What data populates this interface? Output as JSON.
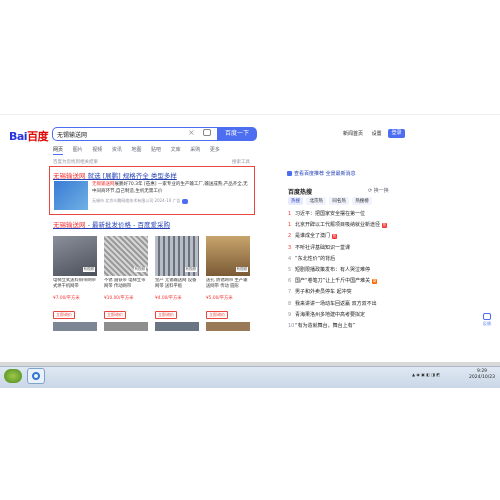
{
  "header": {
    "logo_left": "Bai",
    "logo_right": "百度",
    "search_value": "无锡输送网",
    "search_button": "百度一下",
    "links": [
      "新闻首页",
      "设置"
    ],
    "login": "登录"
  },
  "tabs": [
    "网页",
    "图片",
    "视频",
    "资讯",
    "地图",
    "贴吧",
    "文库",
    "采购",
    "更多"
  ],
  "result_hint": "百度为您找到相关结果",
  "search_tools": "搜索工具",
  "ad": {
    "title_kw": "无锡输送网",
    "title_rest": " 就选 [展鹏] 规格齐全 类型多样",
    "desc_kw": "无锡输送网",
    "desc_rest": "展鹏好70.3年 [莅惠] —家专业的生产输工厂,输送成熟,产品齐全,无中间商环节,自己制造,生机无需工价",
    "meta": "无锡市 北京众鹏网络技术有限公司 2024-10",
    "meta_tag": "广告"
  },
  "sub_result": {
    "title_kw": "无锡输送网",
    "title_rest": " - 最新批发价格 - 百度爱采购"
  },
  "products": [
    {
      "desc": "电梯立式送料铜带网带式烘干机网带",
      "price": "¥7.00/平方米",
      "button": "立即询价",
      "tag": "有视频"
    },
    {
      "desc": "不锈 圆铁带 电梯立带 网带 传动网带",
      "price": "¥10.00/平方米",
      "button": "立即询价",
      "tag": "有视频"
    },
    {
      "desc": "金产 无锡输送网 设备 网带 送料平板",
      "price": "¥4.00/平方米",
      "button": "立即询价",
      "tag": "有视频"
    },
    {
      "desc": "送孔 防锈网带 生产输 送网带 传动 圆形",
      "price": "¥5.00/平方米",
      "button": "立即询价",
      "tag": "有视频"
    }
  ],
  "sidebar": {
    "notice": "查看百度推荐 全景最新消息",
    "hot_title": "百度热搜",
    "change": "换一换",
    "hot_tabs": [
      "热搜",
      "北京热",
      "同名热",
      "热搜榜"
    ],
    "hot_items": [
      {
        "n": "1",
        "text": "习近平：把国家安全摆在第一位",
        "badge": ""
      },
      {
        "n": "1",
        "text": "北京开辟以工代赈项目吸纳就业新途径",
        "badge": "热"
      },
      {
        "n": "2",
        "text": "是谁成全了澳门",
        "badge": "热"
      },
      {
        "n": "3",
        "text": "不听社评基础知识一堂课",
        "badge": ""
      },
      {
        "n": "4",
        "text": "“东北性价”的背后",
        "badge": ""
      },
      {
        "n": "5",
        "text": "短剧限播政策发布：有人哭泣难停",
        "badge": ""
      },
      {
        "n": "6",
        "text": "国产“卷笔刀”让上千斤中国产难关",
        "badge": "新"
      },
      {
        "n": "7",
        "text": "男子和外卖员停车 起冲突",
        "badge": ""
      },
      {
        "n": "8",
        "text": "我来讲讲一场动车回返赢 双方双不出",
        "badge": ""
      },
      {
        "n": "9",
        "text": "青海果洛州多地建中高考要拟定",
        "badge": ""
      },
      {
        "n": "10",
        "text": "“有为造就舞台，舞台上有”",
        "badge": ""
      }
    ]
  },
  "float_label": "反馈",
  "taskbar": {
    "time": "9:29",
    "date": "2024/10/23"
  }
}
